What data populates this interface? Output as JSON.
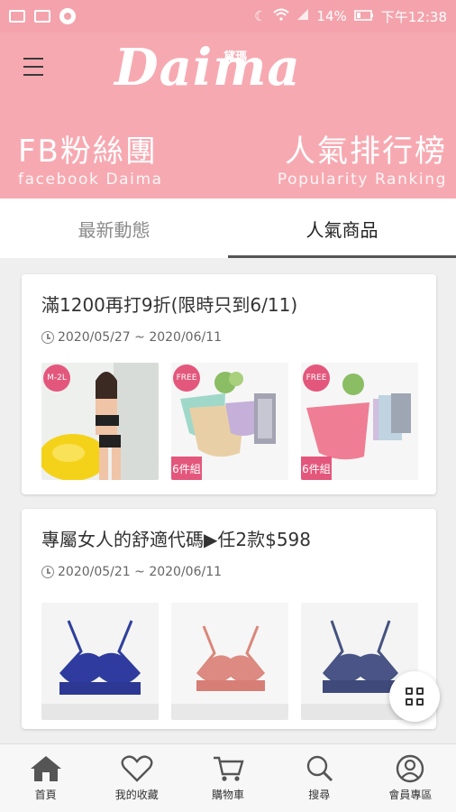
{
  "status": {
    "battery": "14%",
    "time": "下午12:38"
  },
  "header": {
    "logo": "Daima",
    "logo_small": "黛瑪",
    "banner_left_title": "FB粉絲團",
    "banner_left_subtitle": "facebook Daima",
    "banner_right_title": "人氣排行榜",
    "banner_right_subtitle": "Popularity Ranking"
  },
  "tabs": [
    {
      "label": "最新動態",
      "active": false
    },
    {
      "label": "人氣商品",
      "active": true
    }
  ],
  "cards": [
    {
      "title": "滿1200再打9折(限時只到6/11)",
      "date": "2020/05/27 ~ 2020/06/11",
      "thumbs": [
        {
          "badge": "M-2L",
          "set": ""
        },
        {
          "badge": "FREE",
          "set": "6件組"
        },
        {
          "badge": "FREE",
          "set": "6件組"
        }
      ]
    },
    {
      "title": "專屬女人的舒適代碼▶任2款$598",
      "date": "2020/05/21 ~ 2020/06/11",
      "thumbs": [
        {
          "badge": "",
          "set": ""
        },
        {
          "badge": "",
          "set": ""
        },
        {
          "badge": "",
          "set": ""
        }
      ]
    }
  ],
  "bottom_nav": [
    {
      "label": "首頁",
      "icon": "home-icon"
    },
    {
      "label": "我的收藏",
      "icon": "heart-icon"
    },
    {
      "label": "購物車",
      "icon": "cart-icon"
    },
    {
      "label": "搜尋",
      "icon": "search-icon"
    },
    {
      "label": "會員專區",
      "icon": "user-icon"
    }
  ],
  "colors": {
    "brand_pink": "#f7a9b1",
    "status_pink": "#f4a3ac",
    "badge_pink": "#e4577c"
  }
}
